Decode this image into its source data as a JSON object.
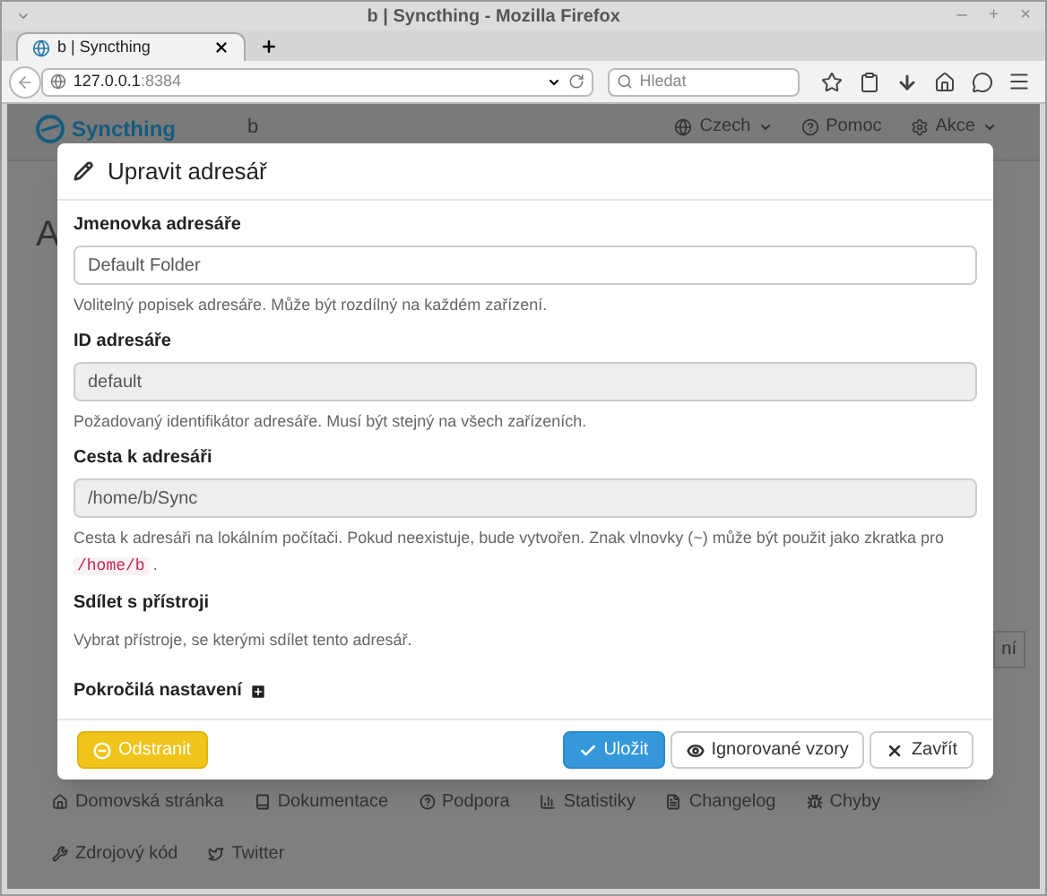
{
  "window": {
    "title": "b | Syncthing - Mozilla Firefox",
    "controls": [
      "–",
      "+",
      "×"
    ]
  },
  "tabs": [
    {
      "label": "b | Syncthing",
      "selected": true
    }
  ],
  "address_bar": {
    "host": "127.0.0.1",
    "port": ":8384"
  },
  "search": {
    "placeholder": "Hledat"
  },
  "navbar": {
    "brand": "Syncthing",
    "device": "b",
    "items": [
      "Czech",
      "Pomoc",
      "Akce"
    ]
  },
  "page": {
    "heading": "A",
    "button_fragment": "ní"
  },
  "dialog": {
    "title": "Upravit adresář",
    "fields": [
      {
        "kind": "input",
        "label": "Jmenovka adresáře",
        "value": "Default Folder",
        "disabled": false,
        "help": "Volitelný popisek adresáře. Může být rozdílný na každém zařízení."
      },
      {
        "kind": "input",
        "label": "ID adresáře",
        "value": "default",
        "disabled": true,
        "help": "Požadovaný identifikátor adresáře. Musí být stejný na všech zařízeních."
      },
      {
        "kind": "input",
        "label": "Cesta k adresáři",
        "value": "/home/b/Sync",
        "disabled": true,
        "help": "Cesta k adresáři na lokálním počítači. Pokud neexistuje, bude vytvořen. Znak vlnovky (~) může být použit jako zkratka pro",
        "help_code": "/home/b",
        "help_end": "."
      },
      {
        "kind": "text",
        "label": "Sdílet s přístroji",
        "help": "Vybrat přístroje, se kterými sdílet tento adresář."
      }
    ],
    "advanced": {
      "label": "Pokročilá nastavení",
      "expanded": false
    },
    "buttons": [
      {
        "kind": "remove",
        "label": "Odstranit"
      },
      {
        "kind": "save",
        "label": "Uložit"
      },
      {
        "kind": "ignore",
        "label": "Ignorované vzory"
      },
      {
        "kind": "close",
        "label": "Zavřít"
      }
    ]
  },
  "footer": [
    {
      "kind": "home",
      "label": "Domovská stránka"
    },
    {
      "kind": "docs",
      "label": "Dokumentace"
    },
    {
      "kind": "support",
      "label": "Podpora"
    },
    {
      "kind": "stats",
      "label": "Statistiky"
    },
    {
      "kind": "changelog",
      "label": "Changelog"
    },
    {
      "kind": "bugs",
      "label": "Chyby"
    },
    {
      "kind": "source",
      "label": "Zdrojový kód"
    },
    {
      "kind": "twitter",
      "label": "Twitter"
    }
  ]
}
